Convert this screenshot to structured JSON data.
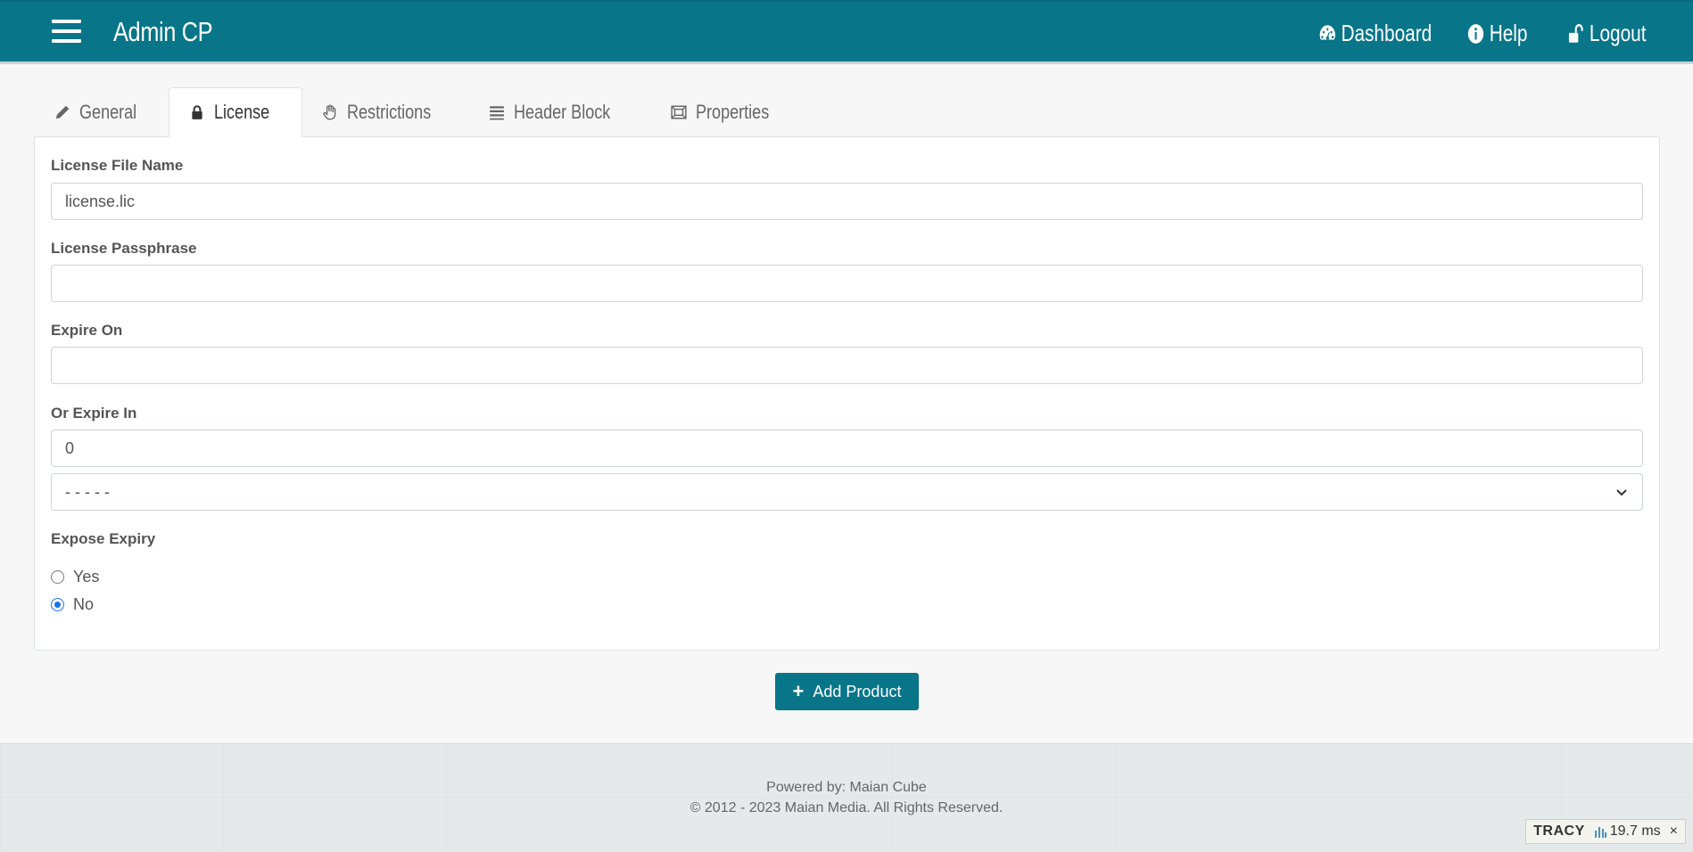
{
  "header": {
    "brand": "Admin CP",
    "nav": [
      {
        "label": "Dashboard",
        "icon": "dashboard-icon"
      },
      {
        "label": "Help",
        "icon": "info-icon"
      },
      {
        "label": "Logout",
        "icon": "unlock-icon"
      }
    ]
  },
  "tabs": [
    {
      "label": "General",
      "icon": "pencil-icon",
      "active": false
    },
    {
      "label": "License",
      "icon": "lock-icon",
      "active": true
    },
    {
      "label": "Restrictions",
      "icon": "hand-icon",
      "active": false
    },
    {
      "label": "Header Block",
      "icon": "list-icon",
      "active": false
    },
    {
      "label": "Properties",
      "icon": "properties-icon",
      "active": false
    }
  ],
  "form": {
    "license_file_name": {
      "label": "License File Name",
      "value": "license.lic"
    },
    "license_passphrase": {
      "label": "License Passphrase",
      "value": ""
    },
    "expire_on": {
      "label": "Expire On",
      "value": ""
    },
    "or_expire_in": {
      "label": "Or Expire In",
      "value": "0",
      "unit_selected": "- - - - -"
    },
    "expose_expiry": {
      "label": "Expose Expiry",
      "options": [
        {
          "label": "Yes",
          "checked": false
        },
        {
          "label": "No",
          "checked": true
        }
      ]
    }
  },
  "actions": {
    "add_product": "Add Product"
  },
  "footer": {
    "powered_by": "Powered by: Maian Cube",
    "copyright": "© 2012 - 2023 Maian Media. All Rights Reserved."
  },
  "tracy": {
    "name": "TRACY",
    "time": "19.7 ms",
    "close": "×"
  },
  "colors": {
    "brand": "#087589",
    "radio_checked": "#1a73e8"
  }
}
